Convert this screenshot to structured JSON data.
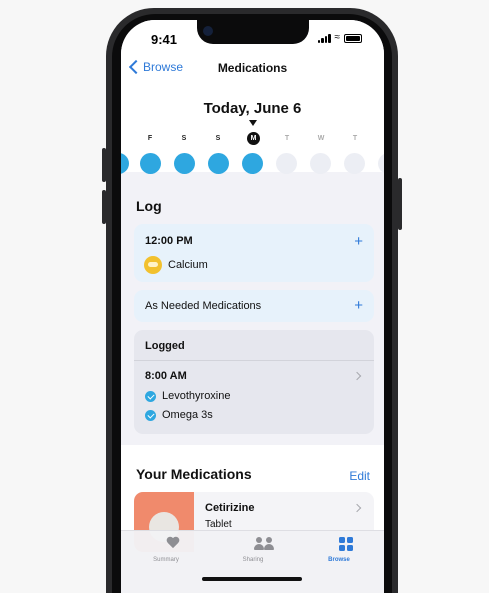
{
  "status_bar": {
    "time": "9:41"
  },
  "nav": {
    "back_label": "Browse",
    "title": "Medications"
  },
  "date_header": {
    "title": "Today, June 6"
  },
  "week_strip": {
    "days": [
      {
        "letter": "F",
        "state": "logged"
      },
      {
        "letter": "S",
        "state": "logged"
      },
      {
        "letter": "S",
        "state": "logged"
      },
      {
        "letter": "M",
        "state": "selected"
      },
      {
        "letter": "T",
        "state": "future"
      },
      {
        "letter": "W",
        "state": "future"
      },
      {
        "letter": "T",
        "state": "future"
      }
    ]
  },
  "log": {
    "heading": "Log",
    "scheduled": {
      "time": "12:00 PM",
      "medication": "Calcium",
      "add_icon": "+"
    },
    "as_needed": {
      "label": "As Needed Medications",
      "add_icon": "+"
    },
    "logged": {
      "heading": "Logged",
      "time": "8:00 AM",
      "medications": [
        "Levothyroxine",
        "Omega 3s"
      ]
    }
  },
  "your_medications": {
    "heading": "Your Medications",
    "edit_label": "Edit",
    "items": [
      {
        "name": "Cetirizine",
        "form": "Tablet"
      }
    ]
  },
  "tab_bar": {
    "tabs": [
      {
        "label": "Summary",
        "icon": "heart-icon",
        "active": false
      },
      {
        "label": "Sharing",
        "icon": "people-icon",
        "active": false
      },
      {
        "label": "Browse",
        "icon": "grid-icon",
        "active": true
      }
    ]
  },
  "colors": {
    "accent": "#2f7ad8",
    "logged_dot": "#2ea7e0",
    "calcium_pill": "#f2c12e",
    "cetirizine_thumb": "#f08a6c"
  }
}
